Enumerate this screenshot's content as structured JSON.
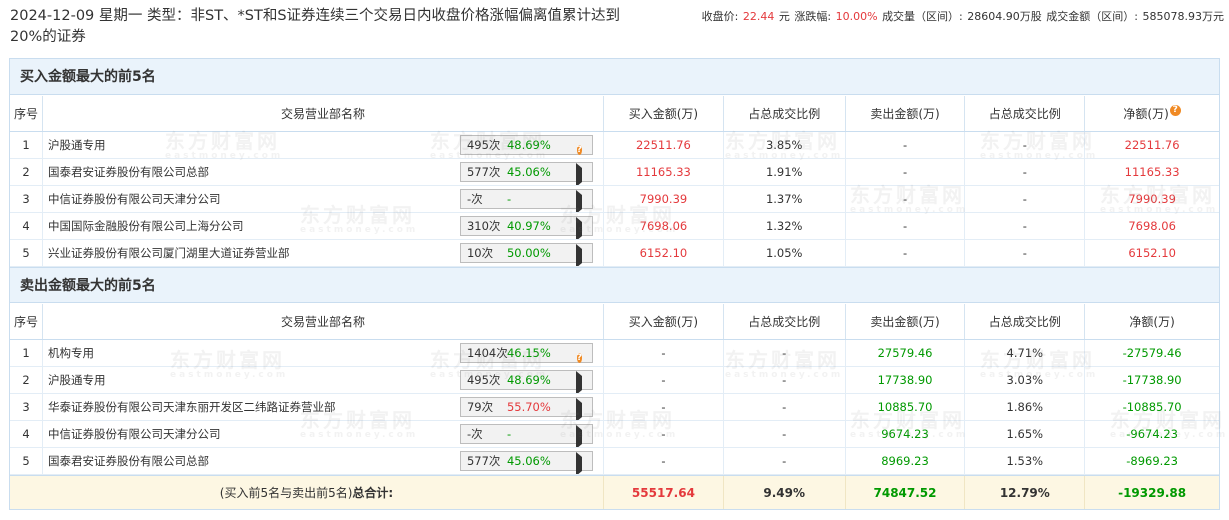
{
  "header": {
    "title": "2024-12-09 星期一 类型：非ST、*ST和S证券连续三个交易日内收盘价格涨幅偏离值累计达到20%的证券",
    "close_label": "收盘价:",
    "close_value": "22.44",
    "close_unit": "元",
    "change_label": "涨跌幅:",
    "change_value": "10.00%",
    "volume_label": "成交量（区间）:",
    "volume_value": "28604.90万股",
    "amount_label": "成交金额（区间）:",
    "amount_value": "585078.93万元"
  },
  "columns": {
    "seq": "序号",
    "dept": "交易营业部名称",
    "buy": "买入金额(万)",
    "buy_pct": "占总成交比例",
    "sell": "卖出金额(万)",
    "sell_pct": "占总成交比例",
    "net": "净额(万)"
  },
  "buy_section": {
    "title": "买入金额最大的前5名",
    "rows": [
      {
        "seq": "1",
        "name": "沪股通专用",
        "count": "495次",
        "rate": "48.69%",
        "icon": "question",
        "buy": "22511.76",
        "buy_pct": "3.85%",
        "sell": "-",
        "sell_pct": "-",
        "net": "22511.76"
      },
      {
        "seq": "2",
        "name": "国泰君安证券股份有限公司总部",
        "count": "577次",
        "rate": "45.06%",
        "icon": "arrow",
        "buy": "11165.33",
        "buy_pct": "1.91%",
        "sell": "-",
        "sell_pct": "-",
        "net": "11165.33"
      },
      {
        "seq": "3",
        "name": "中信证券股份有限公司天津分公司",
        "count": "-次",
        "rate": "-",
        "icon": "arrow",
        "buy": "7990.39",
        "buy_pct": "1.37%",
        "sell": "-",
        "sell_pct": "-",
        "net": "7990.39"
      },
      {
        "seq": "4",
        "name": "中国国际金融股份有限公司上海分公司",
        "count": "310次",
        "rate": "40.97%",
        "icon": "arrow",
        "buy": "7698.06",
        "buy_pct": "1.32%",
        "sell": "-",
        "sell_pct": "-",
        "net": "7698.06"
      },
      {
        "seq": "5",
        "name": "兴业证券股份有限公司厦门湖里大道证券营业部",
        "count": "10次",
        "rate": "50.00%",
        "icon": "arrow",
        "buy": "6152.10",
        "buy_pct": "1.05%",
        "sell": "-",
        "sell_pct": "-",
        "net": "6152.10"
      }
    ]
  },
  "sell_section": {
    "title": "卖出金额最大的前5名",
    "rows": [
      {
        "seq": "1",
        "name": "机构专用",
        "count": "1404次",
        "rate": "46.15%",
        "icon": "question",
        "buy": "-",
        "buy_pct": "-",
        "sell": "27579.46",
        "sell_pct": "4.71%",
        "net": "-27579.46"
      },
      {
        "seq": "2",
        "name": "沪股通专用",
        "count": "495次",
        "rate": "48.69%",
        "icon": "arrow",
        "buy": "-",
        "buy_pct": "-",
        "sell": "17738.90",
        "sell_pct": "3.03%",
        "net": "-17738.90"
      },
      {
        "seq": "3",
        "name": "华泰证券股份有限公司天津东丽开发区二纬路证券营业部",
        "count": "79次",
        "rate": "55.70%",
        "rate_red": true,
        "icon": "arrow",
        "buy": "-",
        "buy_pct": "-",
        "sell": "10885.70",
        "sell_pct": "1.86%",
        "net": "-10885.70"
      },
      {
        "seq": "4",
        "name": "中信证券股份有限公司天津分公司",
        "count": "-次",
        "rate": "-",
        "icon": "arrow",
        "buy": "-",
        "buy_pct": "-",
        "sell": "9674.23",
        "sell_pct": "1.65%",
        "net": "-9674.23"
      },
      {
        "seq": "5",
        "name": "国泰君安证券股份有限公司总部",
        "count": "577次",
        "rate": "45.06%",
        "icon": "arrow",
        "buy": "-",
        "buy_pct": "-",
        "sell": "8969.23",
        "sell_pct": "1.53%",
        "net": "-8969.23"
      }
    ]
  },
  "total": {
    "label_prefix": "(买入前5名与卖出前5名)",
    "label_bold": "总合计:",
    "buy": "55517.64",
    "buy_pct": "9.49%",
    "sell": "74847.52",
    "sell_pct": "12.79%",
    "net": "-19329.88"
  },
  "watermark": {
    "cn": "东方财富网",
    "en": "eastmoney.com"
  },
  "colors": {
    "red": "#e4393c",
    "green": "#009900",
    "header_bg": "#eaf3fb",
    "total_bg": "#fdf7e3",
    "border": "#c9ddef",
    "icon_orange": "#f08a24"
  }
}
